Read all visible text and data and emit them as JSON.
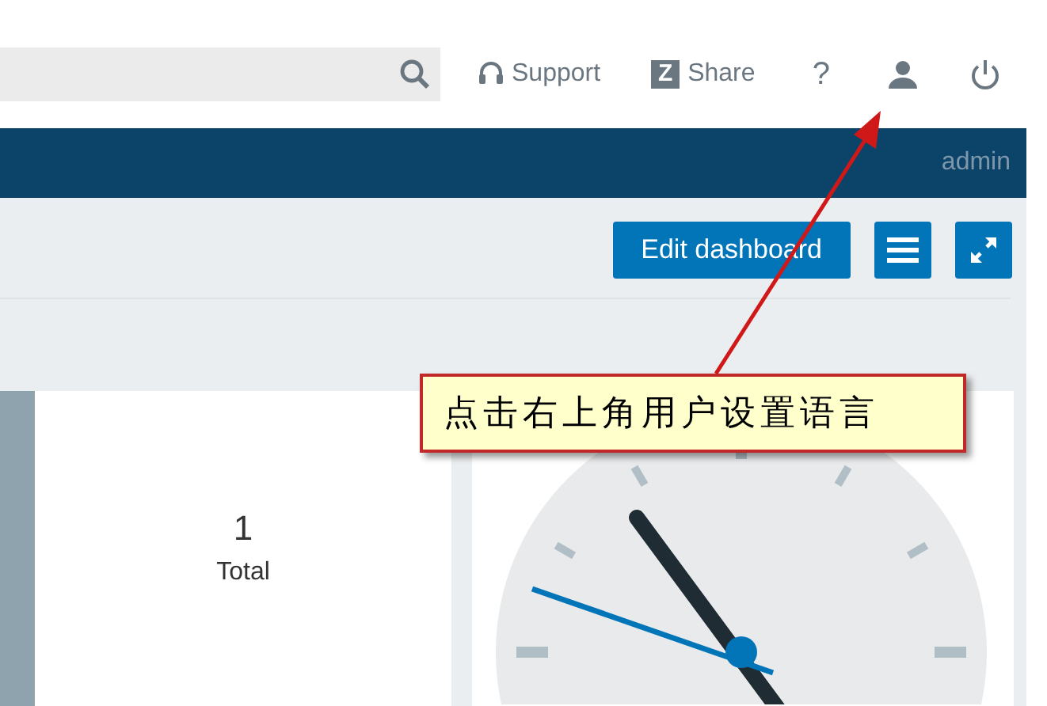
{
  "header": {
    "links": [
      {
        "kind": "support",
        "label": "Support"
      },
      {
        "kind": "share",
        "label": "Share",
        "icon_letter": "Z"
      },
      {
        "kind": "help",
        "label": "?"
      },
      {
        "kind": "user"
      },
      {
        "kind": "signout"
      }
    ]
  },
  "nav_bar": {
    "user": "admin"
  },
  "toolbar": {
    "edit_button": "Edit dashboard"
  },
  "widgets": [
    {
      "kind": "counter",
      "value": "1",
      "label": "Total"
    },
    {
      "kind": "clock"
    }
  ],
  "annotation": {
    "text": "点击右上角用户设置语言"
  }
}
